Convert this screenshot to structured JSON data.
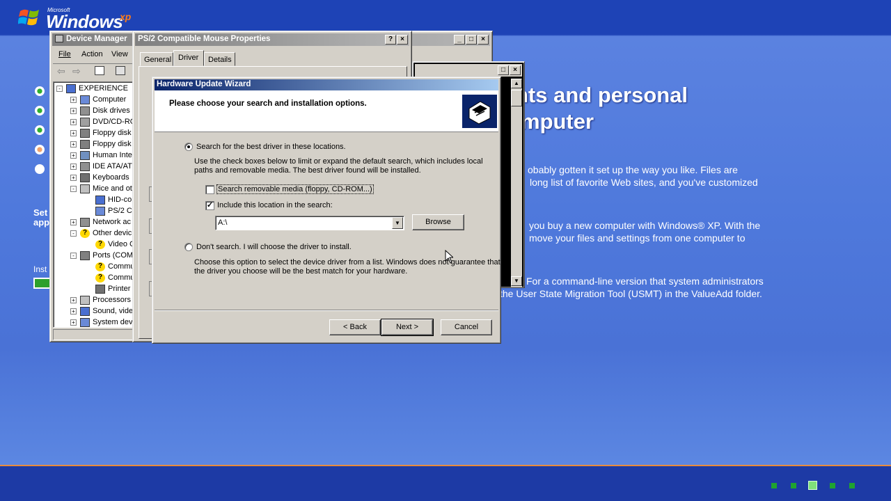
{
  "setup": {
    "logo": {
      "microsoft": "Microsoft",
      "windows": "Windows",
      "xp": "xp"
    },
    "side_text_1": "Set",
    "side_text_1b": "app",
    "side_text_2": "Inst",
    "headline_1": "nts and personal",
    "headline_2": "mputer",
    "para1_line1": "obably gotten it set up the way you like. Files are",
    "para1_line2": "long list of favorite Web sites, and you've customized",
    "para2_line1": "you buy a new computer with Windows® XP. With the",
    "para2_line2": "move your files and settings from one computer to",
    "para3_line1": "For a command-line version that system administrators",
    "para3_line2": "the User State Migration Tool (USMT) in the ValueAdd folder."
  },
  "device_manager": {
    "title": "Device Manager",
    "menu": [
      "File",
      "Action",
      "View"
    ],
    "tree": [
      {
        "label": "EXPERIENCE",
        "level": 0,
        "pm": "-"
      },
      {
        "label": "Computer",
        "level": 1,
        "pm": "+"
      },
      {
        "label": "Disk drives",
        "level": 1,
        "pm": "+"
      },
      {
        "label": "DVD/CD-RO",
        "level": 1,
        "pm": "+"
      },
      {
        "label": "Floppy disk",
        "level": 1,
        "pm": "+"
      },
      {
        "label": "Floppy disk",
        "level": 1,
        "pm": "+"
      },
      {
        "label": "Human Inte",
        "level": 1,
        "pm": "+"
      },
      {
        "label": "IDE ATA/AT",
        "level": 1,
        "pm": "+"
      },
      {
        "label": "Keyboards",
        "level": 1,
        "pm": "+"
      },
      {
        "label": "Mice and ot",
        "level": 1,
        "pm": "-"
      },
      {
        "label": "HID-cor",
        "level": 2,
        "pm": ""
      },
      {
        "label": "PS/2 Co",
        "level": 2,
        "pm": ""
      },
      {
        "label": "Network ac",
        "level": 1,
        "pm": "+"
      },
      {
        "label": "Other devic",
        "level": 1,
        "pm": "-"
      },
      {
        "label": "Video C",
        "level": 2,
        "pm": ""
      },
      {
        "label": "Ports (COM",
        "level": 1,
        "pm": "-"
      },
      {
        "label": "Commu",
        "level": 2,
        "pm": ""
      },
      {
        "label": "Commu",
        "level": 2,
        "pm": ""
      },
      {
        "label": "Printer",
        "level": 2,
        "pm": ""
      },
      {
        "label": "Processors",
        "level": 1,
        "pm": "+"
      },
      {
        "label": "Sound, vide",
        "level": 1,
        "pm": "+"
      },
      {
        "label": "System dev",
        "level": 1,
        "pm": "+"
      }
    ]
  },
  "properties": {
    "title": "PS/2 Compatible Mouse Properties",
    "tabs": [
      "General",
      "Driver",
      "Details"
    ],
    "active_tab": "Driver"
  },
  "wizard": {
    "title": "Hardware Update Wizard",
    "heading": "Please choose your search and installation options.",
    "option1_label": "Search for the best driver in these locations.",
    "option1_desc_1": "Use the check boxes below to limit or expand the default search, which includes local",
    "option1_desc_2": "paths and removable media. The best driver found will be installed.",
    "check1_label": "Search removable media (floppy, CD-ROM...)",
    "check1_checked": false,
    "check2_label": "Include this location in the search:",
    "check2_checked": true,
    "location_value": "A:\\",
    "browse_label": "Browse",
    "option2_label": "Don't search. I will choose the driver to install.",
    "option2_desc_1": "Choose this option to select the device driver from a list.  Windows does not guarantee that",
    "option2_desc_2": "the driver you choose will be the best match for your hardware.",
    "back_label": "< Back",
    "next_label": "Next >",
    "cancel_label": "Cancel"
  }
}
